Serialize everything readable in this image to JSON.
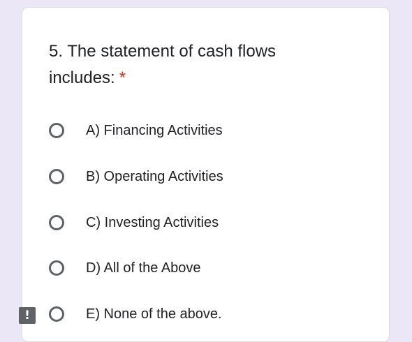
{
  "question": {
    "text": "5. The statement of cash flows includes:",
    "required_marker": "*"
  },
  "options": [
    {
      "label": "A) Financing Activities",
      "selected": false
    },
    {
      "label": "B) Operating Activities",
      "selected": false
    },
    {
      "label": "C) Investing Activities",
      "selected": false
    },
    {
      "label": "D) All of the Above",
      "selected": false
    },
    {
      "label": "E) None of the above.",
      "selected": false
    }
  ],
  "report_button": {
    "glyph": "!",
    "icon": "report-problem-icon"
  },
  "colors": {
    "background": "#ece7f6",
    "card": "#ffffff",
    "required": "#d93025",
    "radio_border": "#5f6368",
    "text": "#202124"
  }
}
